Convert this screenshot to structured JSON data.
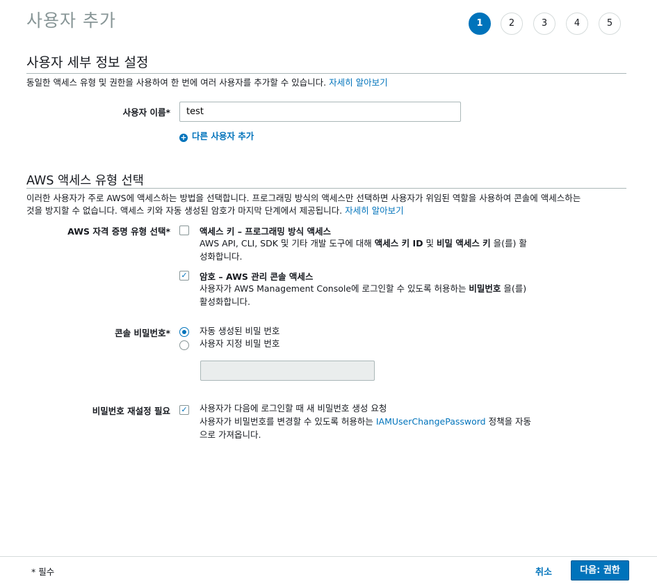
{
  "header": {
    "title": "사용자 추가"
  },
  "steps": [
    "1",
    "2",
    "3",
    "4",
    "5"
  ],
  "active_step": "1",
  "user_details": {
    "title": "사용자 세부 정보 설정",
    "description": "동일한 액세스 유형 및 권한을 사용하여 한 번에 여러 사용자를 추가할 수 있습니다.",
    "learn_more": "자세히 알아보기",
    "username_label": "사용자 이름*",
    "username_value": "test",
    "add_user_label": "다른 사용자 추가"
  },
  "access_type": {
    "title": "AWS 액세스 유형 선택",
    "description_line1": "이러한 사용자가 주로 AWS에 액세스하는 방법을 선택합니다. 프로그래밍 방식의 액세스만 선택하면 사용자가 위임된 역할을 사용하여 콘솔에 액세스하는",
    "description_line2": "것을 방지할 수 없습니다. 액세스 키와 자동 생성된 암호가 마지막 단계에서 제공됩니다.",
    "learn_more": "자세히 알아보기",
    "credential_label": "AWS 자격 증명 유형 선택*",
    "options": [
      {
        "title": "액세스 키 – 프로그래밍 방식 액세스",
        "checked": false,
        "text_a": "AWS API, CLI, SDK 및 기타 개발 도구에 대해 ",
        "bold_a": "액세스 키 ID",
        "text_b": " 및 ",
        "bold_b": "비밀 액세스 키",
        "text_c": " 을(를) 활",
        "text_d": "성화합니다."
      },
      {
        "title": "암호 – AWS 관리 콘솔 액세스",
        "checked": true,
        "text_a": "사용자가 AWS Management Console에 로그인할 수 있도록 허용하는 ",
        "bold_a": "비밀번호",
        "text_b": " 을(를)",
        "text_d": "활성화합니다."
      }
    ]
  },
  "console_password": {
    "label": "콘솔 비밀번호*",
    "options": [
      {
        "label": "자동 생성된 비밀 번호",
        "selected": true
      },
      {
        "label": "사용자 지정 비밀 번호",
        "selected": false
      }
    ],
    "custom_value": ""
  },
  "password_reset": {
    "label": "비밀번호 재설정 필요",
    "checked": true,
    "line1": "사용자가 다음에 로그인할 때 새 비밀번호 생성 요청",
    "line2_a": "사용자가 비밀번호를 변경할 수 있도록 허용하는 ",
    "line2_link": "IAMUserChangePassword",
    "line2_b": " 정책을 자동",
    "line3": "으로 가져옵니다."
  },
  "footer": {
    "required_note": "* 필수",
    "cancel_label": "취소",
    "next_label": "다음: 권한"
  },
  "colors": {
    "accent": "#0073bb",
    "title_gray": "#879596",
    "border": "#aab7b8"
  },
  "icons": {
    "add_user": "plus-circle-icon",
    "checkbox": "checkmark-icon"
  }
}
